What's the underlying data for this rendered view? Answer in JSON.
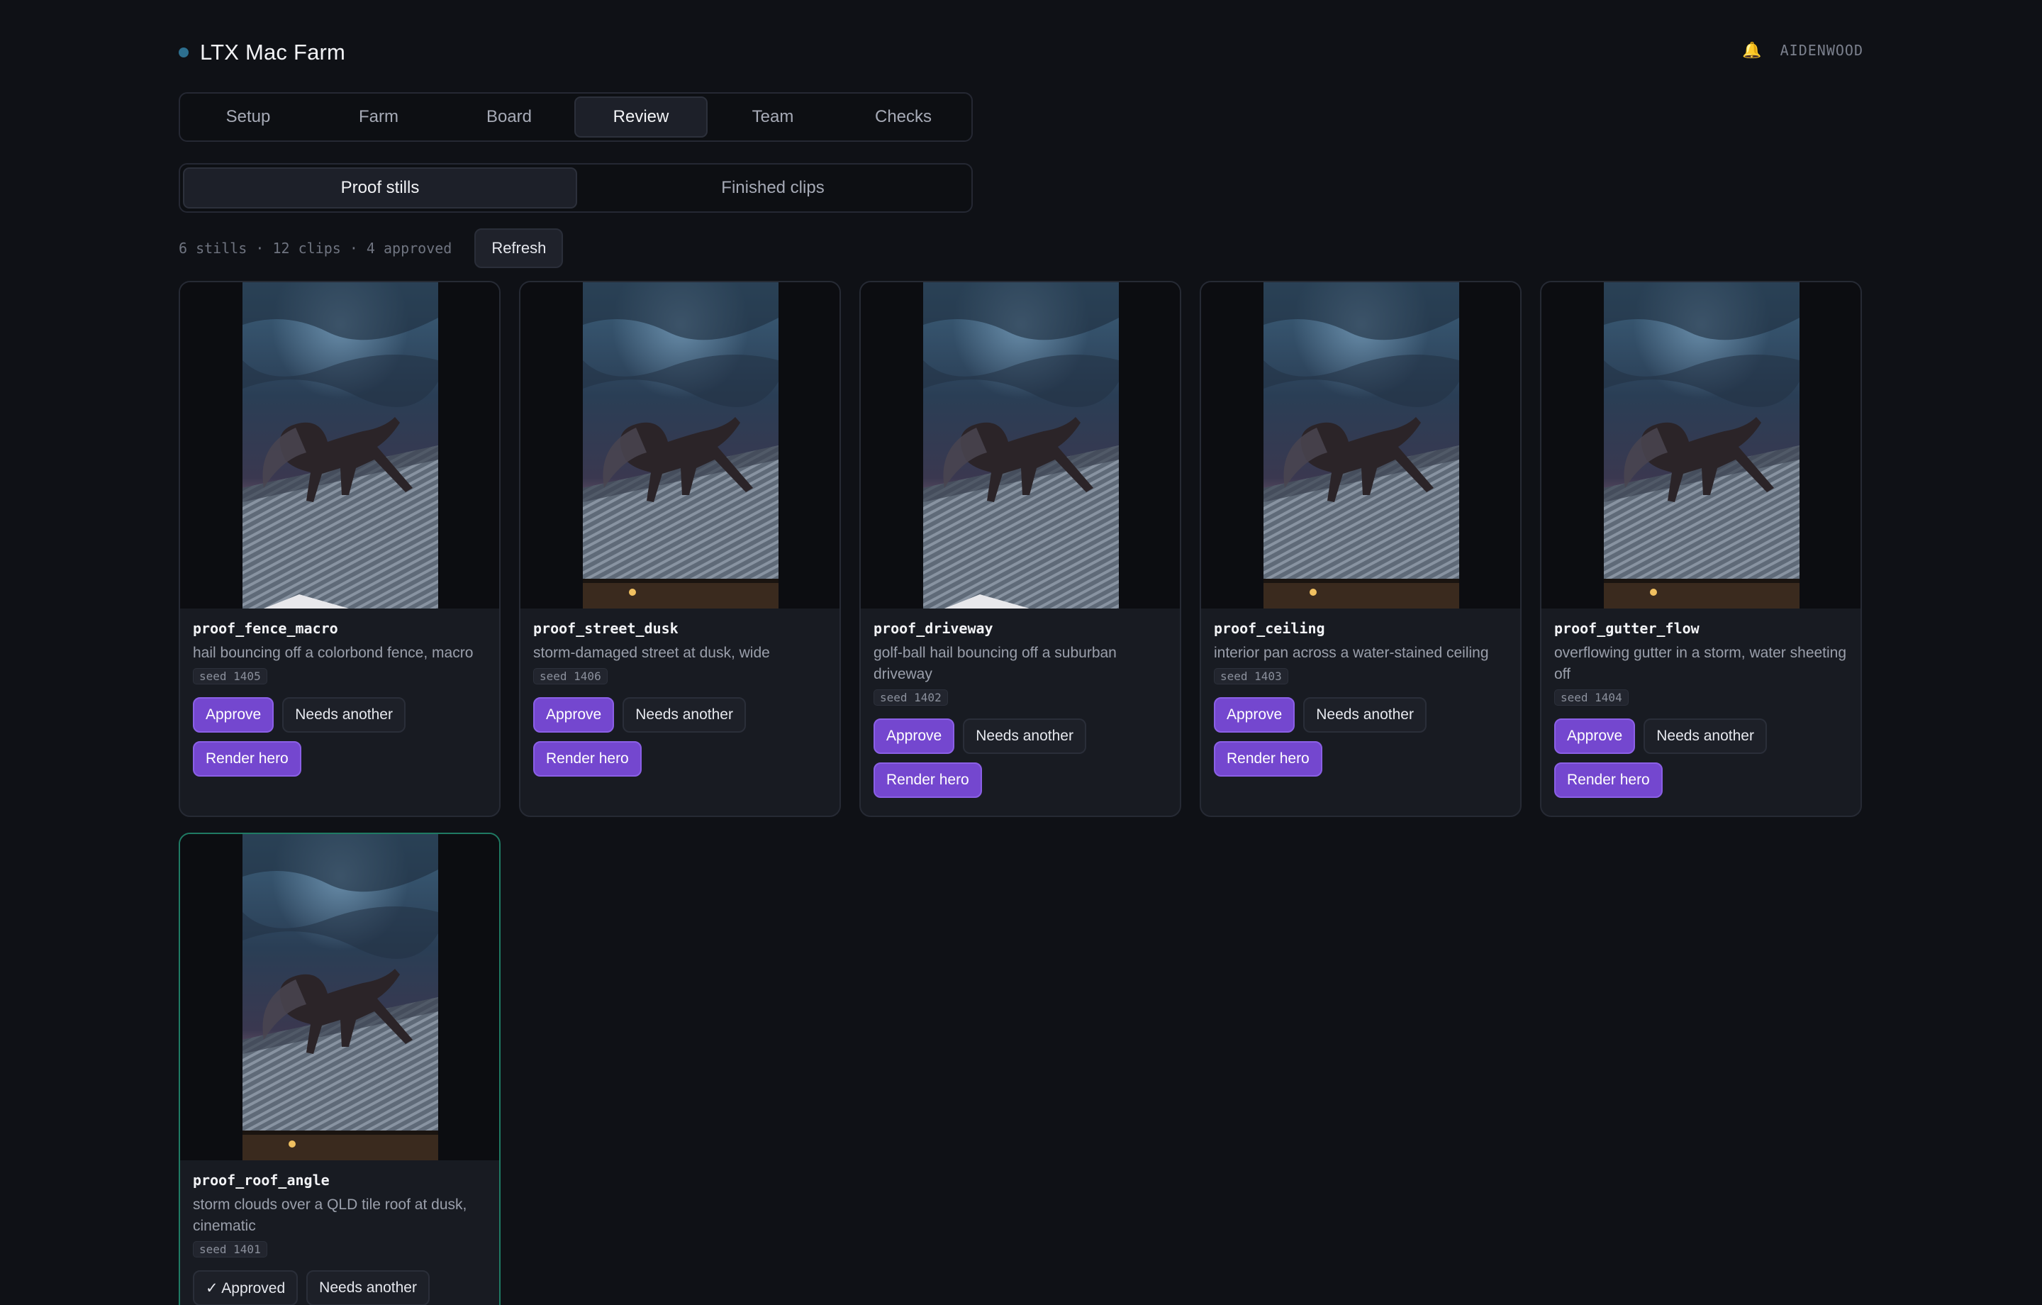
{
  "app": {
    "title": "LTX Mac Farm",
    "user": "AIDENWOOD",
    "bell_icon": "bell-icon"
  },
  "tabs": [
    {
      "label": "Setup"
    },
    {
      "label": "Farm"
    },
    {
      "label": "Board"
    },
    {
      "label": "Review",
      "active": true
    },
    {
      "label": "Team"
    },
    {
      "label": "Checks"
    }
  ],
  "subtabs": [
    {
      "label": "Proof stills",
      "active": true
    },
    {
      "label": "Finished clips"
    }
  ],
  "stats": {
    "text": "6 stills · 12 clips · 4 approved",
    "refresh_label": "Refresh"
  },
  "buttons": {
    "approve": "Approve",
    "needs_another": "Needs another",
    "render_hero": "Render hero",
    "approved": "✓ Approved"
  },
  "cards": [
    {
      "name": "proof_fence_macro",
      "desc": "hail bouncing off a colorbond fence, macro",
      "seed": "seed 1405",
      "approved": false
    },
    {
      "name": "proof_street_dusk",
      "desc": "storm-damaged street at dusk, wide",
      "seed": "seed 1406",
      "approved": false
    },
    {
      "name": "proof_driveway",
      "desc": "golf-ball hail bouncing off a suburban driveway",
      "seed": "seed 1402",
      "approved": false
    },
    {
      "name": "proof_ceiling",
      "desc": "interior pan across a water-stained ceiling",
      "seed": "seed 1403",
      "approved": false
    },
    {
      "name": "proof_gutter_flow",
      "desc": "overflowing gutter in a storm, water sheeting off",
      "seed": "seed 1404",
      "approved": false
    },
    {
      "name": "proof_roof_angle",
      "desc": "storm clouds over a QLD tile roof at dusk, cinematic",
      "seed": "seed 1401",
      "approved": true
    }
  ],
  "colors": {
    "accent": "#7447cf",
    "approved_border": "#1f7a63",
    "background": "#0f1116"
  }
}
